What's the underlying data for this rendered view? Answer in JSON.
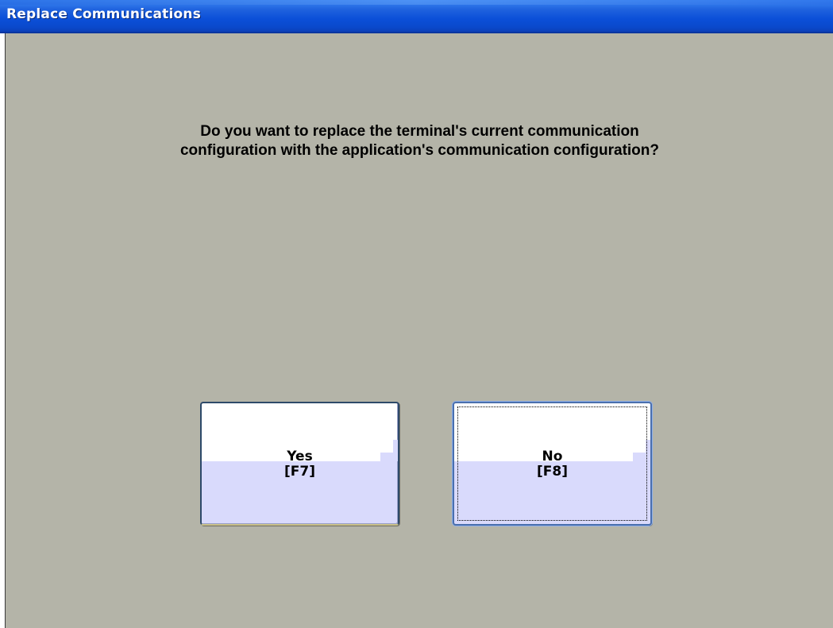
{
  "window": {
    "title": "Replace Communications"
  },
  "dialog": {
    "question_line1": "Do you want to replace the terminal's current communication",
    "question_line2": "configuration with the application's communication configuration?"
  },
  "buttons": {
    "yes": {
      "label": "Yes",
      "shortcut": "[F7]"
    },
    "no": {
      "label": "No",
      "shortcut": "[F8]",
      "focused": true
    }
  },
  "colors": {
    "titlebar": "#0b4fd8",
    "client_background": "#b4b4a8",
    "button_top": "#ffffff",
    "button_bottom": "#d9dafc"
  }
}
